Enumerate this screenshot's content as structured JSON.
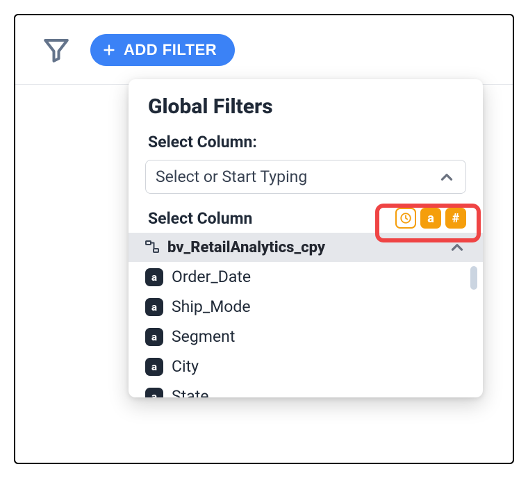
{
  "toolbar": {
    "add_filter_label": "ADD FILTER"
  },
  "popover": {
    "title": "Global Filters",
    "select_label": "Select Column:",
    "select_placeholder": "Select or Start Typing"
  },
  "dropdown": {
    "header_label": "Select Column",
    "type_filters": {
      "datetime": {
        "name": "datetime-type-icon",
        "active": false
      },
      "text": {
        "name": "text-type-icon",
        "label": "a",
        "active": true
      },
      "number": {
        "name": "number-type-icon",
        "label": "#",
        "active": true
      }
    },
    "group": {
      "name": "bv_RetailAnalytics_cpy",
      "expanded": true
    },
    "columns": [
      {
        "label": "Order_Date",
        "type": "text",
        "badge": "a"
      },
      {
        "label": "Ship_Mode",
        "type": "text",
        "badge": "a"
      },
      {
        "label": "Segment",
        "type": "text",
        "badge": "a"
      },
      {
        "label": "City",
        "type": "text",
        "badge": "a"
      },
      {
        "label": "State",
        "type": "text",
        "badge": "a"
      }
    ]
  }
}
